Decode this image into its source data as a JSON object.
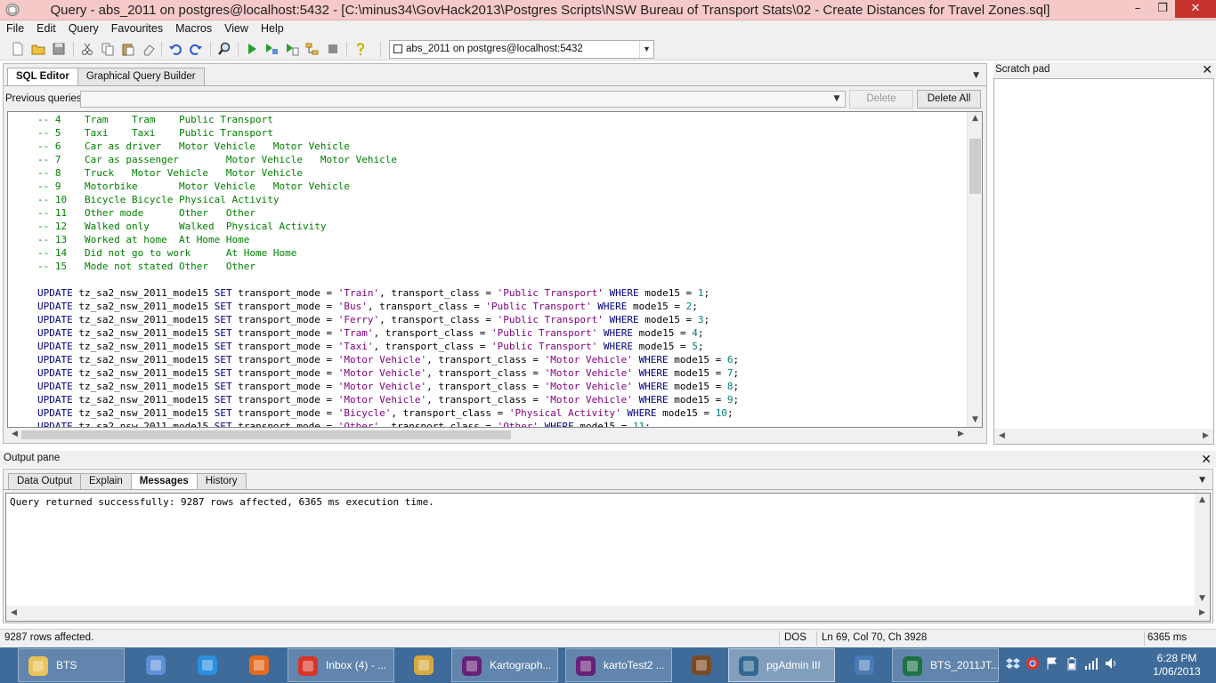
{
  "window": {
    "title": "Query - abs_2011 on postgres@localhost:5432 - [C:\\minus34\\GovHack2013\\Postgres Scripts\\NSW Bureau of Transport Stats\\02 - Create Distances for Travel Zones.sql]",
    "minimize": "–",
    "restore": "❐",
    "close": "✕"
  },
  "menu": {
    "items": [
      "File",
      "Edit",
      "Query",
      "Favourites",
      "Macros",
      "View",
      "Help"
    ]
  },
  "toolbar": {
    "connection": "abs_2011 on postgres@localhost:5432"
  },
  "editor": {
    "tabs": [
      "SQL Editor",
      "Graphical Query Builder"
    ],
    "previous_queries_label": "Previous queries",
    "delete_label": "Delete",
    "delete_all_label": "Delete All",
    "comment_lines": [
      "-- 4    Tram    Tram    Public Transport",
      "-- 5    Taxi    Taxi    Public Transport",
      "-- 6    Car as driver   Motor Vehicle   Motor Vehicle",
      "-- 7    Car as passenger        Motor Vehicle   Motor Vehicle",
      "-- 8    Truck   Motor Vehicle   Motor Vehicle",
      "-- 9    Motorbike       Motor Vehicle   Motor Vehicle",
      "-- 10   Bicycle Bicycle Physical Activity",
      "-- 11   Other mode      Other   Other",
      "-- 12   Walked only     Walked  Physical Activity",
      "-- 13   Worked at home  At Home Home",
      "-- 14   Did not go to work      At Home Home",
      "-- 15   Mode not stated Other   Other"
    ],
    "update_table": " tz_sa2_nsw_2011_mode15 ",
    "update_rows": [
      {
        "mode": "'Train'",
        "cls": "'Public Transport'",
        "n": "1"
      },
      {
        "mode": "'Bus'",
        "cls": "'Public Transport'",
        "n": "2"
      },
      {
        "mode": "'Ferry'",
        "cls": "'Public Transport'",
        "n": "3"
      },
      {
        "mode": "'Tram'",
        "cls": "'Public Transport'",
        "n": "4"
      },
      {
        "mode": "'Taxi'",
        "cls": "'Public Transport'",
        "n": "5"
      },
      {
        "mode": "'Motor Vehicle'",
        "cls": "'Motor Vehicle'",
        "n": "6"
      },
      {
        "mode": "'Motor Vehicle'",
        "cls": "'Motor Vehicle'",
        "n": "7"
      },
      {
        "mode": "'Motor Vehicle'",
        "cls": "'Motor Vehicle'",
        "n": "8"
      },
      {
        "mode": "'Motor Vehicle'",
        "cls": "'Motor Vehicle'",
        "n": "9"
      },
      {
        "mode": "'Bicycle'",
        "cls": "'Physical Activity'",
        "n": "10"
      },
      {
        "mode": "'Other'",
        "cls": "'Other'",
        "n": "11"
      }
    ]
  },
  "scratch": {
    "title": "Scratch pad",
    "close": "✕"
  },
  "output": {
    "title": "Output pane",
    "close": "✕",
    "tabs": [
      "Data Output",
      "Explain",
      "Messages",
      "History"
    ],
    "active_tab": "Messages",
    "message": "Query returned successfully: 9287 rows affected, 6365 ms execution time."
  },
  "status": {
    "rows": "9287 rows affected.",
    "format": "DOS",
    "position": "Ln 69, Col 70, Ch 3928",
    "time": "6365 ms"
  },
  "taskbar": {
    "tasks": [
      {
        "label": "BTS",
        "icon": "folder-icon",
        "color": "#e8c35a"
      },
      {
        "label": "",
        "icon": "control-panel-icon",
        "color": "#5c8fd6"
      },
      {
        "label": "",
        "icon": "internet-explorer-icon",
        "color": "#2a8fe0"
      },
      {
        "label": "",
        "icon": "firefox-icon",
        "color": "#e66a1f"
      },
      {
        "label": "Inbox (4) - ...",
        "icon": "chrome-icon",
        "color": "#d9352b"
      },
      {
        "label": "",
        "icon": "paint-icon",
        "color": "#d8a840"
      },
      {
        "label": "Kartograph...",
        "icon": "visual-studio-icon",
        "color": "#68217a"
      },
      {
        "label": "kartoTest2 ...",
        "icon": "visual-studio-icon",
        "color": "#68217a"
      },
      {
        "label": "",
        "icon": "notebook-icon",
        "color": "#7a4b22"
      },
      {
        "label": "pgAdmin III",
        "icon": "pgadmin-elephant-icon",
        "color": "#336791"
      },
      {
        "label": "",
        "icon": "server-icon",
        "color": "#4a7ab5"
      },
      {
        "label": "BTS_2011JT...",
        "icon": "excel-icon",
        "color": "#1e7145"
      }
    ],
    "time": "6:28 PM",
    "date": "1/06/2013"
  }
}
